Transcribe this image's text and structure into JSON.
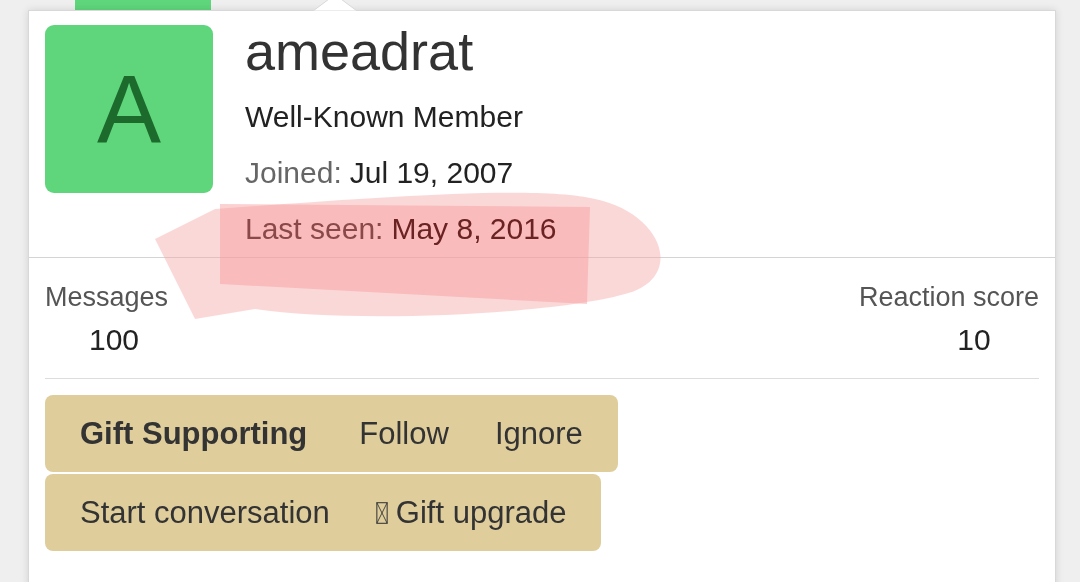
{
  "profile": {
    "avatar_letter": "A",
    "name": "ameadrat",
    "title": "Well-Known Member",
    "facts": [
      {
        "label": "Joined:",
        "value": "Jul 19, 2007",
        "highlighted": false
      },
      {
        "label": "Last seen:",
        "value": "May 8, 2016",
        "highlighted": true
      }
    ]
  },
  "stats": [
    {
      "label": "Messages",
      "value": "100"
    },
    {
      "label": "Reaction score",
      "value": "10"
    }
  ],
  "action_rows": [
    [
      {
        "label": "Gift Supporting",
        "kind": "strong"
      },
      {
        "label": "Follow",
        "kind": "plain"
      },
      {
        "label": "Ignore",
        "kind": "plain"
      }
    ],
    [
      {
        "label": "Start conversation",
        "kind": "plain"
      },
      {
        "label": "Gift upgrade",
        "kind": "glyph"
      }
    ]
  ]
}
